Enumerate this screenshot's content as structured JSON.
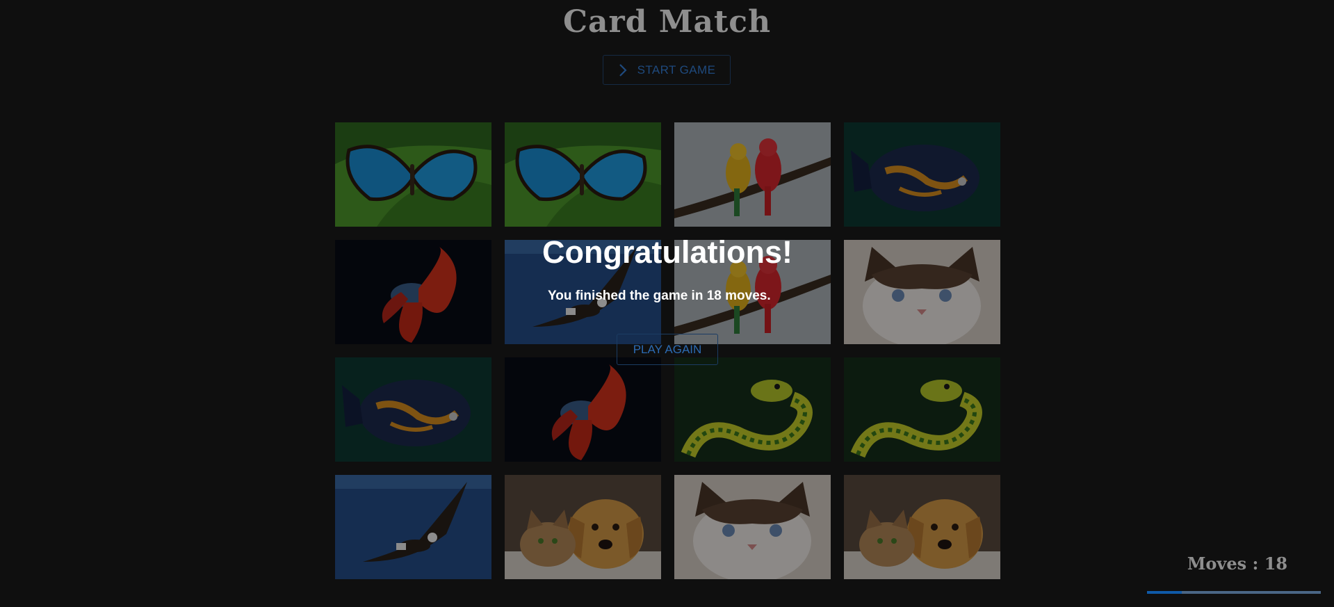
{
  "header": {
    "title": "Card Match",
    "start_label": "START GAME"
  },
  "board": {
    "cards": [
      {
        "image": "blue-morpho-butterfly"
      },
      {
        "image": "blue-morpho-butterfly"
      },
      {
        "image": "parrots-on-branch"
      },
      {
        "image": "oscar-fish"
      },
      {
        "image": "betta-fish"
      },
      {
        "image": "eagle-flying"
      },
      {
        "image": "parrots-on-branch"
      },
      {
        "image": "ragdoll-cat"
      },
      {
        "image": "oscar-fish"
      },
      {
        "image": "betta-fish"
      },
      {
        "image": "green-snake"
      },
      {
        "image": "green-snake"
      },
      {
        "image": "eagle-flying"
      },
      {
        "image": "cat-and-dog"
      },
      {
        "image": "ragdoll-cat"
      },
      {
        "image": "cat-and-dog"
      }
    ]
  },
  "modal": {
    "title": "Congratulations!",
    "message": "You finished the game in 18 moves.",
    "play_again_label": "PLAY AGAIN"
  },
  "status": {
    "moves_label": "Moves : 18",
    "progress": 0.2
  },
  "colors": {
    "accent": "#2c6bb3",
    "background": "#0f0f0f",
    "muted_text": "#8e8e8e"
  }
}
